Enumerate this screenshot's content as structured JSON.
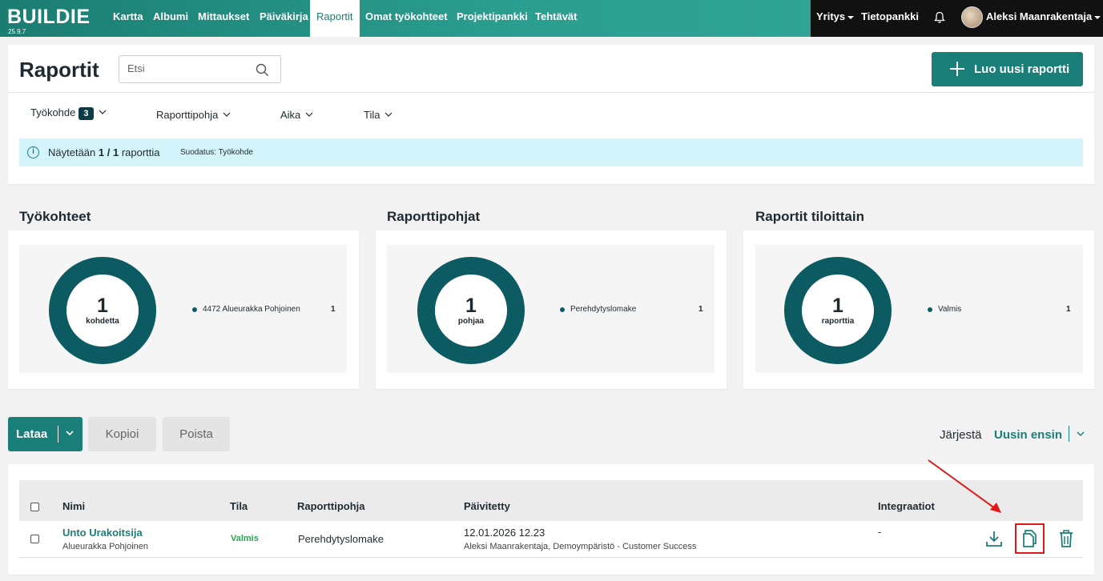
{
  "app": {
    "logo": "BUILDIE",
    "version": "25.9.7"
  },
  "nav": {
    "items": [
      {
        "label": "Kartta"
      },
      {
        "label": "Albumi"
      },
      {
        "label": "Mittaukset"
      },
      {
        "label": "Päiväkirja"
      },
      {
        "label": "Raportit",
        "active": true
      },
      {
        "label": "Omat työkohteet"
      },
      {
        "label": "Projektipankki"
      },
      {
        "label": "Tehtävät"
      }
    ],
    "company_label": "Yritys",
    "knowledge_label": "Tietopankki",
    "user_name": "Aleksi Maanrakentaja"
  },
  "header": {
    "title": "Raportit",
    "search_placeholder": "Etsi",
    "create_label": "Luo uusi raportti"
  },
  "filters": {
    "items": [
      {
        "label": "Työkohde",
        "badge": "3"
      },
      {
        "label": "Raporttipohja"
      },
      {
        "label": "Aika"
      },
      {
        "label": "Tila"
      }
    ]
  },
  "info": {
    "prefix": "Näytetään",
    "count": "1 / 1",
    "suffix": "raporttia",
    "filter_text": "Suodatus: Työkohde"
  },
  "charts": [
    {
      "title": "Työkohteet",
      "center_value": "1",
      "center_label": "kohdetta",
      "legend": [
        {
          "label": "4472 Alueurakka Pohjoinen",
          "value": "1"
        }
      ]
    },
    {
      "title": "Raporttipohjat",
      "center_value": "1",
      "center_label": "pohjaa",
      "legend": [
        {
          "label": "Perehdytyslomake",
          "value": "1"
        }
      ]
    },
    {
      "title": "Raportit tiloittain",
      "center_value": "1",
      "center_label": "raporttia",
      "legend": [
        {
          "label": "Valmis",
          "value": "1"
        }
      ]
    }
  ],
  "colors": {
    "accent": "#1a7f78",
    "donut": "#0c5a62",
    "status_ok": "#2da44e",
    "highlight": "#e01818"
  },
  "actions": {
    "download_label": "Lataa",
    "copy_label": "Kopioi",
    "delete_label": "Poista",
    "sort_label": "Järjestä",
    "sort_value": "Uusin ensin"
  },
  "table": {
    "columns": [
      "Nimi",
      "Tila",
      "Raporttipohja",
      "Päivitetty",
      "Integraatiot"
    ],
    "rows": [
      {
        "name": "Unto Urakoitsija",
        "site": "Alueurakka Pohjoinen",
        "status": "Valmis",
        "template": "Perehdytyslomake",
        "updated": "12.01.2026 12.23",
        "updated_by": "Aleksi Maanrakentaja, Demoympäristö - Customer Success",
        "integrations": "-"
      }
    ]
  }
}
